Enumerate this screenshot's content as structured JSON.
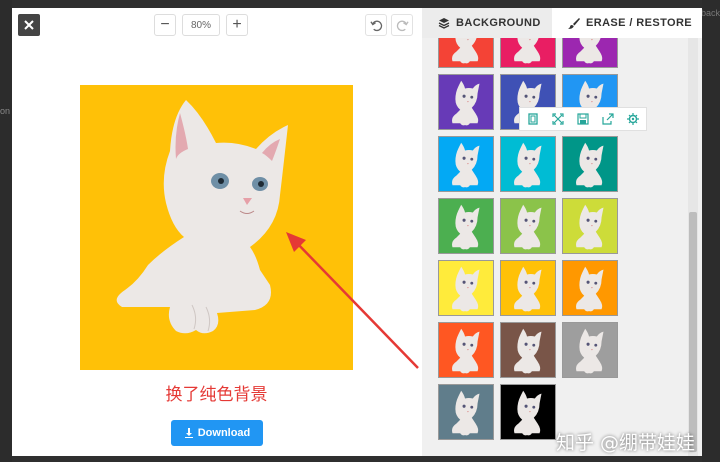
{
  "page": {
    "left_clip_text": "on",
    "right_clip_text": "back"
  },
  "editor": {
    "zoom": {
      "minus_label": "−",
      "value": "80%",
      "plus_label": "+"
    },
    "caption": "换了纯色背景",
    "download_label": "Download",
    "canvas_background": "#ffc107"
  },
  "panel": {
    "tabs": [
      {
        "label": "BACKGROUND",
        "icon": "layers-icon"
      },
      {
        "label": "ERASE / RESTORE",
        "icon": "brush-icon"
      }
    ],
    "swatches": [
      "#f44336",
      "#e91e63",
      "#9c27b0",
      "#673ab7",
      "#3f51b5",
      "#2196f3",
      "#03a9f4",
      "#00bcd4",
      "#009688",
      "#4caf50",
      "#8bc34a",
      "#cddc39",
      "#ffeb3b",
      "#ffc107",
      "#ff9800",
      "#ff5722",
      "#795548",
      "#9e9e9e",
      "#607d8b",
      "#000000"
    ],
    "edit_tools": [
      "copy-icon",
      "fit-icon",
      "save-icon",
      "share-icon",
      "settings-icon"
    ]
  },
  "watermark": "知乎 @绷带娃娃",
  "colors": {
    "accent_blue": "#2196f3",
    "caption_red": "#e53935",
    "toolbar_green": "#26a69a",
    "arrow_red": "#e53935"
  }
}
